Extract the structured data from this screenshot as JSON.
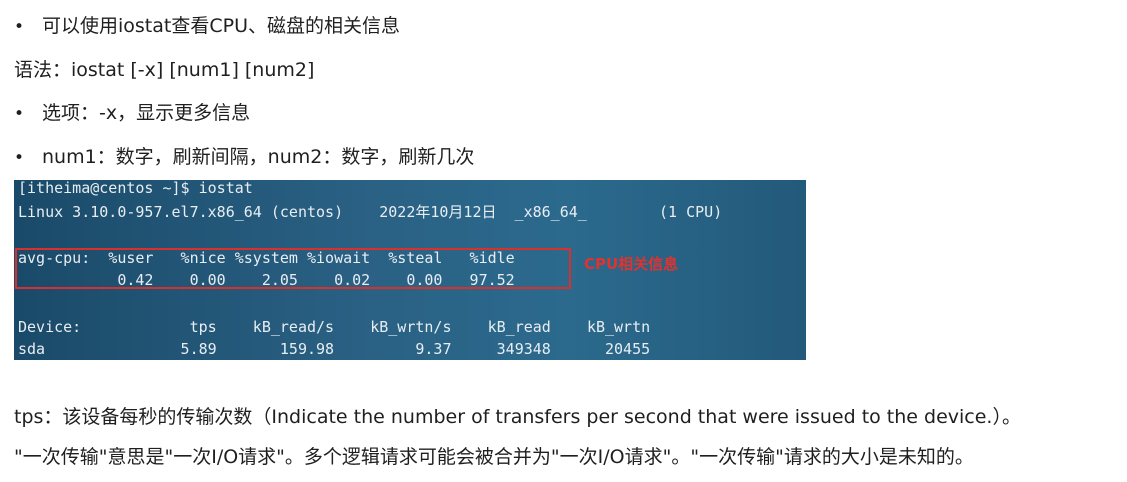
{
  "doc": {
    "bullet_symbol": "•",
    "line1": "可以使用iostat查看CPU、磁盘的相关信息",
    "line2": "语法：iostat [-x] [num1] [num2]",
    "line3": "选项：-x，显示更多信息",
    "line4": "num1：数字，刷新间隔，num2：数字，刷新几次",
    "line5": "tps：该设备每秒的传输次数（Indicate the number of transfers per second that were issued to the device.）。",
    "line6": "\"一次传输\"意思是\"一次I/O请求\"。多个逻辑请求可能会被合并为\"一次I/O请求\"。\"一次传输\"请求的大小是未知的。"
  },
  "terminal": {
    "prompt_line": "[itheima@centos ~]$ iostat",
    "system_line": "Linux 3.10.0-957.el7.x86_64 (centos)    2022年10月12日  _x86_64_        (1 CPU)",
    "cpu_header": "avg-cpu:  %user   %nice %system %iowait  %steal   %idle",
    "cpu_values": "           0.42    0.00    2.05    0.02    0.00   97.52",
    "device_header": "Device:            tps    kB_read/s    kB_wrtn/s    kB_read    kB_wrtn",
    "device_row": "sda               5.89       159.98         9.37     349348      20455",
    "annotation": "CPU相关信息"
  }
}
